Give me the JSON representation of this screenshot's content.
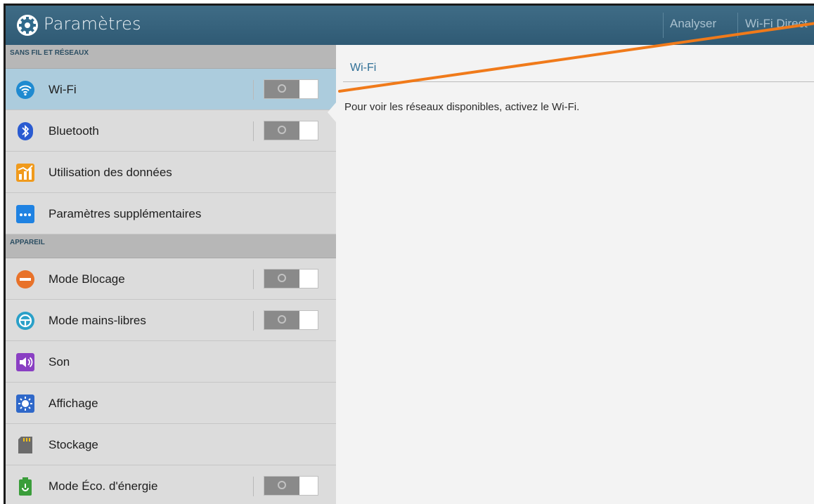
{
  "header": {
    "title": "Paramètres",
    "actions": [
      "Analyser",
      "Wi-Fi Direct"
    ]
  },
  "sidebar": {
    "section_wireless": "SANS FIL ET RÉSEAUX",
    "section_device": "APPAREIL",
    "items": [
      {
        "label": "Wi-Fi",
        "icon": "wifi-icon",
        "toggle": "off",
        "selected": true
      },
      {
        "label": "Bluetooth",
        "icon": "bluetooth-icon",
        "toggle": "off"
      },
      {
        "label": "Utilisation des données",
        "icon": "data-usage-icon"
      },
      {
        "label": "Paramètres supplémentaires",
        "icon": "more-settings-icon"
      },
      {
        "label": "Mode Blocage",
        "icon": "blocking-mode-icon",
        "toggle": "off"
      },
      {
        "label": "Mode mains-libres",
        "icon": "hands-free-icon",
        "toggle": "off"
      },
      {
        "label": "Son",
        "icon": "sound-icon"
      },
      {
        "label": "Affichage",
        "icon": "display-icon"
      },
      {
        "label": "Stockage",
        "icon": "storage-icon"
      },
      {
        "label": "Mode Éco. d'énergie",
        "icon": "power-saving-icon",
        "toggle": "off"
      }
    ]
  },
  "detail": {
    "title": "Wi-Fi",
    "message": "Pour voir les réseaux disponibles, activez le Wi-Fi."
  },
  "colors": {
    "actionbar": "#2f5a74",
    "selected_row": "#acccdd",
    "section_header": "#b7b7b7",
    "callout_line": "#f07a1a",
    "detail_title": "#2f6f96"
  }
}
